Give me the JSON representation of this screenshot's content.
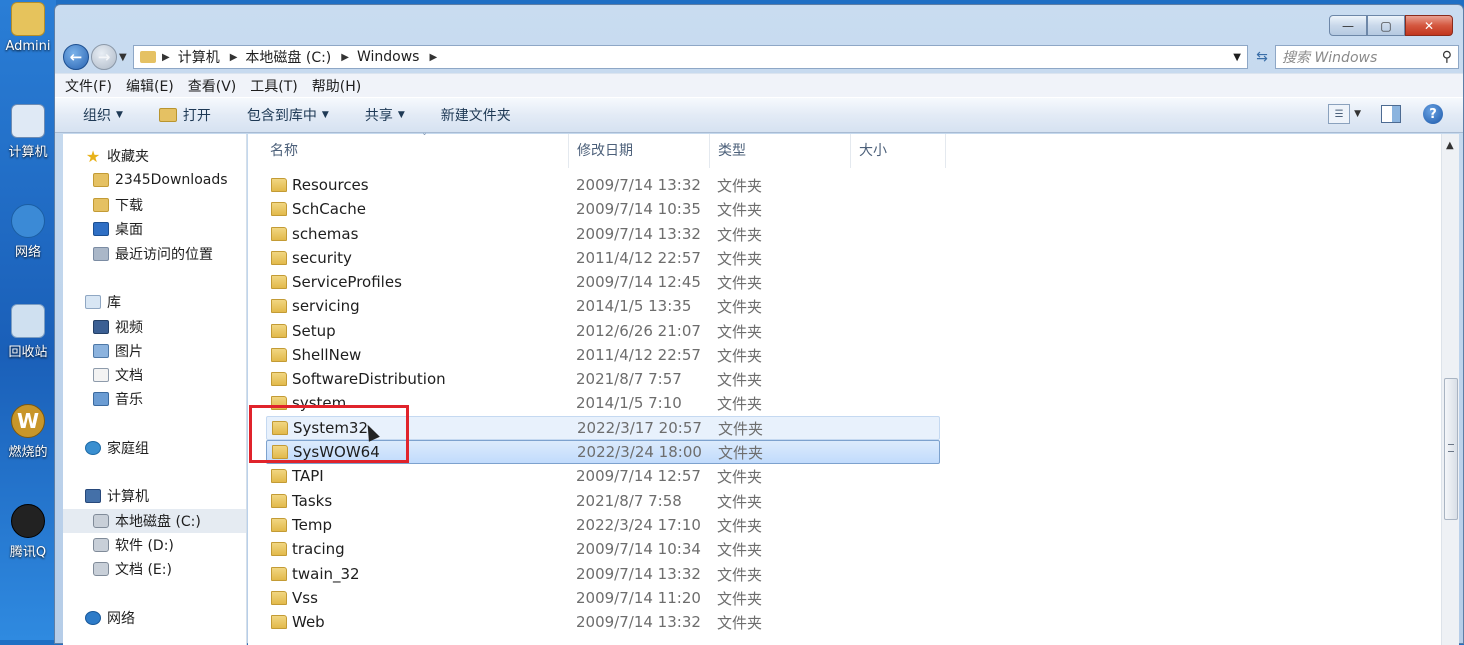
{
  "desktop": {
    "icons": [
      {
        "label": "Admini",
        "icon": "user-folder-icon"
      },
      {
        "label": "计算机",
        "icon": "computer-icon"
      },
      {
        "label": "网络",
        "icon": "network-icon"
      },
      {
        "label": "回收站",
        "icon": "recycle-bin-icon"
      },
      {
        "label": "燃烧的",
        "icon": "game-icon"
      },
      {
        "label": "腾讯Q",
        "icon": "qq-icon"
      }
    ]
  },
  "window": {
    "controls": {
      "minimize": "—",
      "maximize": "▢",
      "close": "✕"
    },
    "address": {
      "crumbs": [
        "计算机",
        "本地磁盘 (C:)",
        "Windows"
      ]
    },
    "search": {
      "placeholder": "搜索 Windows"
    },
    "menu": [
      "文件(F)",
      "编辑(E)",
      "查看(V)",
      "工具(T)",
      "帮助(H)"
    ],
    "toolbar": {
      "organize": "组织",
      "open": "打开",
      "include_library": "包含到库中",
      "share": "共享",
      "new_folder": "新建文件夹"
    }
  },
  "sidebar": {
    "items": [
      {
        "label": "收藏夹",
        "icon": "star-icon"
      },
      {
        "label": "2345Downloads",
        "icon": "folder-icon"
      },
      {
        "label": "下载",
        "icon": "downloads-folder-icon"
      },
      {
        "label": "桌面",
        "icon": "desktop-icon"
      },
      {
        "label": "最近访问的位置",
        "icon": "recent-places-icon"
      },
      {
        "label": "库",
        "icon": "library-icon"
      },
      {
        "label": "视频",
        "icon": "video-library-icon"
      },
      {
        "label": "图片",
        "icon": "pictures-library-icon"
      },
      {
        "label": "文档",
        "icon": "documents-library-icon"
      },
      {
        "label": "音乐",
        "icon": "music-library-icon"
      },
      {
        "label": "家庭组",
        "icon": "homegroup-icon"
      },
      {
        "label": "计算机",
        "icon": "computer-icon"
      },
      {
        "label": "本地磁盘 (C:)",
        "icon": "drive-icon"
      },
      {
        "label": "软件 (D:)",
        "icon": "drive-icon"
      },
      {
        "label": "文档 (E:)",
        "icon": "drive-icon"
      },
      {
        "label": "网络",
        "icon": "network-icon"
      }
    ]
  },
  "file_list": {
    "columns": [
      "名称",
      "修改日期",
      "类型",
      "大小"
    ],
    "rows": [
      {
        "name": "Resources",
        "date": "2009/7/14 13:32",
        "type": "文件夹"
      },
      {
        "name": "SchCache",
        "date": "2009/7/14 10:35",
        "type": "文件夹"
      },
      {
        "name": "schemas",
        "date": "2009/7/14 13:32",
        "type": "文件夹"
      },
      {
        "name": "security",
        "date": "2011/4/12 22:57",
        "type": "文件夹"
      },
      {
        "name": "ServiceProfiles",
        "date": "2009/7/14 12:45",
        "type": "文件夹"
      },
      {
        "name": "servicing",
        "date": "2014/1/5 13:35",
        "type": "文件夹"
      },
      {
        "name": "Setup",
        "date": "2012/6/26 21:07",
        "type": "文件夹"
      },
      {
        "name": "ShellNew",
        "date": "2011/4/12 22:57",
        "type": "文件夹"
      },
      {
        "name": "SoftwareDistribution",
        "date": "2021/8/7 7:57",
        "type": "文件夹"
      },
      {
        "name": "system",
        "date": "2014/1/5 7:10",
        "type": "文件夹"
      },
      {
        "name": "System32",
        "date": "2022/3/17 20:57",
        "type": "文件夹"
      },
      {
        "name": "SysWOW64",
        "date": "2022/3/24 18:00",
        "type": "文件夹"
      },
      {
        "name": "TAPI",
        "date": "2009/7/14 12:57",
        "type": "文件夹"
      },
      {
        "name": "Tasks",
        "date": "2021/8/7 7:58",
        "type": "文件夹"
      },
      {
        "name": "Temp",
        "date": "2022/3/24 17:10",
        "type": "文件夹"
      },
      {
        "name": "tracing",
        "date": "2009/7/14 10:34",
        "type": "文件夹"
      },
      {
        "name": "twain_32",
        "date": "2009/7/14 13:32",
        "type": "文件夹"
      },
      {
        "name": "Vss",
        "date": "2009/7/14 11:20",
        "type": "文件夹"
      },
      {
        "name": "Web",
        "date": "2009/7/14 13:32",
        "type": "文件夹"
      }
    ],
    "hover_row": "System32",
    "selected_row": "SysWOW64"
  },
  "colors": {
    "accent": "#1f6fc4",
    "selection": "#c1dbfc",
    "highlight_box": "#e0232b"
  }
}
